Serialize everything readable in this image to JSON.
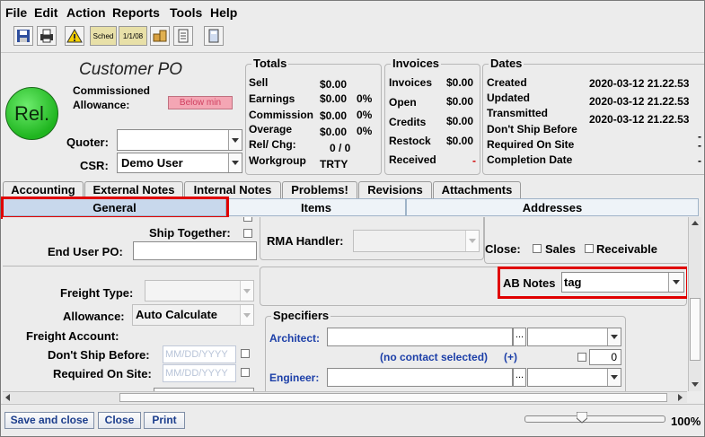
{
  "menu": [
    "File",
    "Edit",
    "Action",
    "Reports",
    "Tools",
    "Help"
  ],
  "toolbar": {
    "sched_label": "Sched",
    "date_label": "1/1/08"
  },
  "header": {
    "title": "Customer PO",
    "status_button": "Rel.",
    "commissioned_label": "Commissioned",
    "allowance_label": "Allowance:",
    "allowance_badge": "Below min",
    "quoter_label": "Quoter:",
    "quoter_value": "",
    "csr_label": "CSR:",
    "csr_value": "Demo User"
  },
  "totals": {
    "title": "Totals",
    "rows": [
      {
        "label": "Sell",
        "value": "$0.00",
        "pct": ""
      },
      {
        "label": "Earnings",
        "value": "$0.00",
        "pct": "0%"
      },
      {
        "label": "Commission",
        "value": "$0.00",
        "pct": "0%"
      },
      {
        "label": "Overage",
        "value": "$0.00",
        "pct": "0%"
      },
      {
        "label": "Rel/ Chg:",
        "value": "0 / 0",
        "pct": ""
      },
      {
        "label": "Workgroup",
        "value": "TRTY",
        "pct": ""
      }
    ]
  },
  "invoices": {
    "title": "Invoices",
    "rows": [
      {
        "label": "Invoices",
        "value": "$0.00"
      },
      {
        "label": "Open",
        "value": "$0.00"
      },
      {
        "label": "Credits",
        "value": "$0.00"
      },
      {
        "label": "Restock",
        "value": "$0.00"
      },
      {
        "label": "Received",
        "value": "-"
      }
    ]
  },
  "dates": {
    "title": "Dates",
    "rows": [
      {
        "label": "Created",
        "value": "2020-03-12 21.22.53"
      },
      {
        "label": "Updated",
        "value": "2020-03-12 21.22.53"
      },
      {
        "label": "Transmitted",
        "value": "2020-03-12 21.22.53"
      },
      {
        "label": "Don't Ship Before",
        "value": "-"
      },
      {
        "label": "Required On Site",
        "value": "-"
      },
      {
        "label": "Completion Date",
        "value": "-"
      }
    ]
  },
  "tabs": [
    "Accounting",
    "External Notes",
    "Internal Notes",
    "Problems!",
    "Revisions",
    "Attachments"
  ],
  "subtabs": [
    "General",
    "Items",
    "Addresses"
  ],
  "general": {
    "ship_together_label": "Ship Together:",
    "end_user_po_label": "End User PO:",
    "end_user_po_value": "",
    "rma_handler_label": "RMA Handler:",
    "close_label": "Close:",
    "close_sales": "Sales",
    "close_receivable": "Receivable",
    "ab_notes_label": "AB Notes",
    "ab_notes_value": "tag",
    "freight_type_label": "Freight Type:",
    "allowance_label": "Allowance:",
    "allowance_value": "Auto Calculate",
    "freight_account_label": "Freight Account:",
    "dont_ship_before_label": "Don't Ship Before:",
    "dont_ship_before_placeholder": "MM/DD/YYYY",
    "required_on_site_label": "Required On Site:",
    "required_on_site_placeholder": "MM/DD/YYYY",
    "specifiers_title": "Specifiers",
    "architect_label": "Architect:",
    "no_contact": "(no contact selected)",
    "plus": "(+)",
    "qty_value": "0",
    "engineer_label": "Engineer:",
    "ellipsis": "..."
  },
  "footer": {
    "save_close": "Save and close",
    "close": "Close",
    "print": "Print",
    "zoom": "100%",
    "zoom_fraction": 0.4
  },
  "colors": {
    "status_green": "#2ecc40",
    "highlight_red": "#e00000",
    "badge_pink": "#f4a6b4",
    "link_blue": "#1c3fa8"
  }
}
